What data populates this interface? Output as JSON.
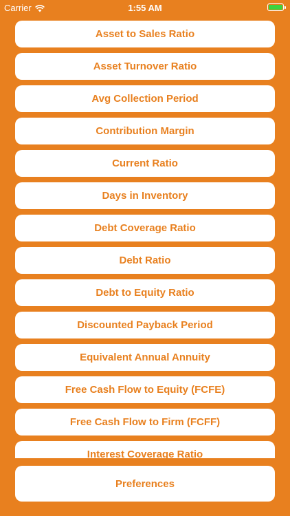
{
  "status_bar": {
    "carrier": "Carrier",
    "time": "1:55 AM",
    "battery_color": "#3ed43e",
    "battery_level": 1.0
  },
  "theme": {
    "background": "#e8801f",
    "button_background": "#ffffff",
    "button_text": "#e8801f"
  },
  "calculators": [
    {
      "label": "Asset to Sales Ratio"
    },
    {
      "label": "Asset Turnover Ratio"
    },
    {
      "label": "Avg Collection Period"
    },
    {
      "label": "Contribution Margin"
    },
    {
      "label": "Current Ratio"
    },
    {
      "label": "Days in Inventory"
    },
    {
      "label": "Debt Coverage Ratio"
    },
    {
      "label": "Debt Ratio"
    },
    {
      "label": "Debt to Equity Ratio"
    },
    {
      "label": "Discounted Payback Period"
    },
    {
      "label": "Equivalent Annual Annuity"
    },
    {
      "label": "Free Cash Flow to Equity (FCFE)"
    },
    {
      "label": "Free Cash Flow to Firm (FCFF)"
    },
    {
      "label": "Interest Coverage Ratio"
    }
  ],
  "footer": {
    "preferences_label": "Preferences"
  }
}
